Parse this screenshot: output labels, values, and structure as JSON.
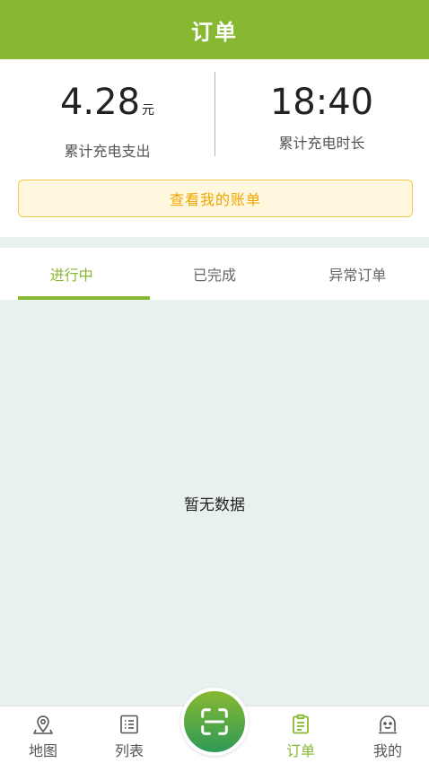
{
  "header": {
    "title": "订单"
  },
  "stats": {
    "spend_value": "4.28",
    "spend_unit": "元",
    "spend_label": "累计充电支出",
    "duration_value": "18:40",
    "duration_label": "累计充电时长"
  },
  "bill_button": {
    "label": "查看我的账单"
  },
  "tabs": [
    {
      "label": "进行中",
      "active": true
    },
    {
      "label": "已完成",
      "active": false
    },
    {
      "label": "异常订单",
      "active": false
    }
  ],
  "content": {
    "empty_text": "暂无数据"
  },
  "bottom_nav": {
    "items": [
      {
        "label": "地图",
        "icon": "map-pin-icon"
      },
      {
        "label": "列表",
        "icon": "list-icon"
      },
      {
        "label": "订单",
        "icon": "clipboard-icon",
        "active": true
      },
      {
        "label": "我的",
        "icon": "user-face-icon"
      }
    ],
    "scan_icon": "scan-icon"
  },
  "colors": {
    "brand_green": "#88b832",
    "bill_text": "#f0a500",
    "bill_border": "#f0c84a",
    "background": "#e8f1ef"
  }
}
